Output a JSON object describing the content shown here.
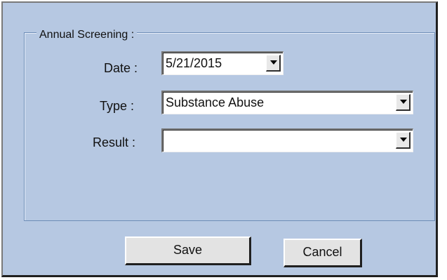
{
  "dialog": {
    "group_title": "Annual Screening :",
    "fields": [
      {
        "label": "Date :",
        "value": "5/21/2015"
      },
      {
        "label": "Type :",
        "value": "Substance Abuse"
      },
      {
        "label": "Result :",
        "value": ""
      }
    ],
    "buttons": {
      "save_label": "Save",
      "cancel_label": "Cancel"
    }
  },
  "icons": {
    "dropdown": "chevron-down-icon"
  }
}
